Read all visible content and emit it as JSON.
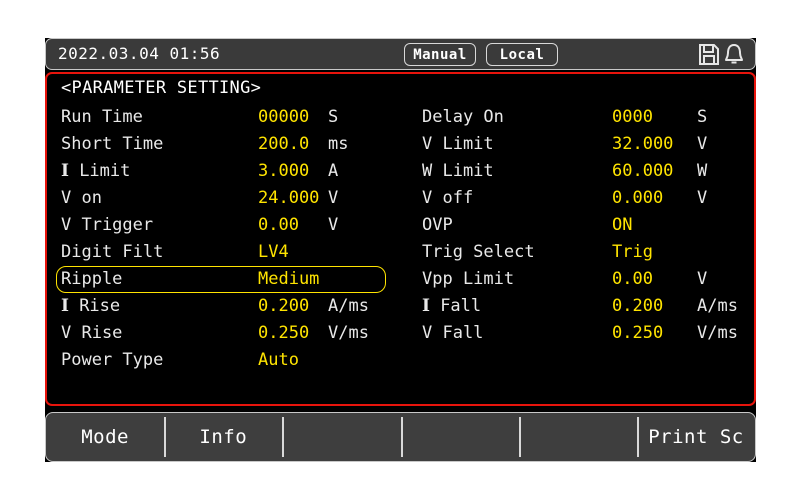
{
  "status_bar": {
    "datetime": "2022.03.04 01:56",
    "mode_badge": "Manual",
    "control_badge": "Local",
    "icons": [
      "save-icon",
      "bell-icon"
    ]
  },
  "panel": {
    "title": "<PARAMETER SETTING>",
    "border_color": "#e8140c",
    "value_color": "#ffe400",
    "label_color": "#e9e9e9",
    "selected_row": "Ripple",
    "rows": [
      {
        "left": {
          "label": "Run Time",
          "value": "00000",
          "unit": "S"
        },
        "right": {
          "label": "Delay On",
          "value": "0000",
          "unit": "S"
        }
      },
      {
        "left": {
          "label": "Short Time",
          "value": "200.0",
          "unit": "ms"
        },
        "right": {
          "label": "V Limit",
          "value": "32.000",
          "unit": "V"
        }
      },
      {
        "left": {
          "label": "I Limit",
          "value": "3.000",
          "unit": "A"
        },
        "right": {
          "label": "W Limit",
          "value": "60.000",
          "unit": "W"
        }
      },
      {
        "left": {
          "label": "V on",
          "value": "24.000",
          "unit": "V"
        },
        "right": {
          "label": "V off",
          "value": "0.000",
          "unit": "V"
        }
      },
      {
        "left": {
          "label": "V Trigger",
          "value": "0.00",
          "unit": "V"
        },
        "right": {
          "label": "OVP",
          "value": "ON",
          "unit": ""
        }
      },
      {
        "left": {
          "label": "Digit Filt",
          "value": "LV4",
          "unit": ""
        },
        "right": {
          "label": "Trig Select",
          "value": "Trig",
          "unit": ""
        }
      },
      {
        "left": {
          "label": "Ripple",
          "value": "Medium",
          "unit": ""
        },
        "right": {
          "label": "Vpp Limit",
          "value": "0.00",
          "unit": "V"
        }
      },
      {
        "left": {
          "label": "I Rise",
          "value": "0.200",
          "unit": "A/ms"
        },
        "right": {
          "label": "I Fall",
          "value": "0.200",
          "unit": "A/ms"
        }
      },
      {
        "left": {
          "label": "V Rise",
          "value": "0.250",
          "unit": "V/ms"
        },
        "right": {
          "label": "V Fall",
          "value": "0.250",
          "unit": "V/ms"
        }
      },
      {
        "left": {
          "label": "Power Type",
          "value": "Auto",
          "unit": ""
        },
        "right": {
          "label": "",
          "value": "",
          "unit": ""
        }
      }
    ]
  },
  "softkeys": [
    {
      "label": "Mode"
    },
    {
      "label": "Info"
    },
    {
      "label": ""
    },
    {
      "label": ""
    },
    {
      "label": ""
    },
    {
      "label": "Print Sc"
    }
  ]
}
